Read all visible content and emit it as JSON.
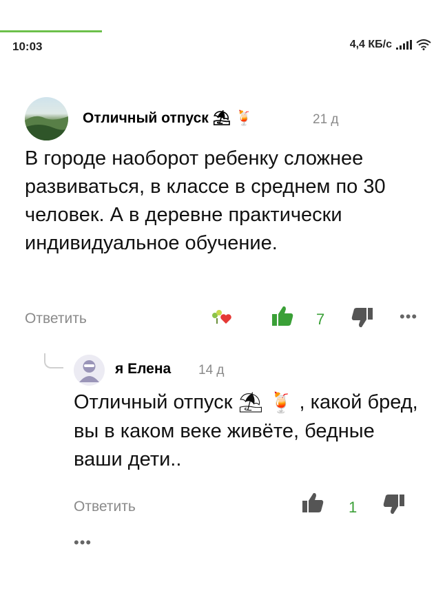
{
  "status_bar": {
    "time": "10:03",
    "network_speed": "4,4 КБ/с",
    "icons": [
      "signal-icon",
      "wifi-icon"
    ]
  },
  "comment": {
    "author": "Отличный отпуск",
    "author_emojis": [
      "⛱",
      "🍹"
    ],
    "age": "21 д",
    "text": "В городе наоборот ребенку сложнее развиваться, в классе в среднем по 30 человек. А в деревне практически индивидуальное обучение.",
    "reply_label": "Ответить",
    "likes": "7",
    "reaction_icon": "flower-heart-icon",
    "more": "•••"
  },
  "reply": {
    "author": "я Елена",
    "age": "14 д",
    "mention": "Отличный отпуск",
    "mention_emojis": [
      "⛱",
      "🍹"
    ],
    "text_after_mention": ", какой бред, вы в каком веке живёте, бедные ваши дети..",
    "reply_label": "Ответить",
    "likes": "1",
    "more": "•••"
  },
  "colors": {
    "accent_green": "#3aa037",
    "progress_green": "#6cc04a",
    "muted_text": "#8a8a8a"
  }
}
